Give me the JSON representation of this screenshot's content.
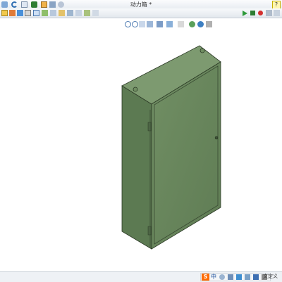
{
  "window": {
    "title": "动力箱 *"
  },
  "toolbar": {
    "help_label": "?",
    "row1_icons": [
      "home-icon",
      "undo-icon",
      "select-icon",
      "rebuild-icon",
      "save-icon",
      "print-icon",
      "options-icon"
    ],
    "row2_icons": [
      "sketch-icon",
      "smart-dimension-icon",
      "line-icon",
      "rectangle-icon",
      "circle-icon",
      "arc-icon",
      "spline-icon",
      "mirror-icon",
      "feature-icon",
      "view-icon",
      "appearance-icon",
      "reference-icon"
    ],
    "run_icons": [
      "play-icon",
      "stop-icon",
      "record-icon",
      "macro-icon",
      "edit-macro-icon"
    ]
  },
  "heads_up": {
    "icons": [
      "zoom-to-fit-icon",
      "zoom-area-icon",
      "previous-view-icon",
      "section-view-icon",
      "view-orientation-icon",
      "display-style-icon",
      "hide-show-icon",
      "edit-appearance-icon",
      "apply-scene-icon",
      "view-settings-icon"
    ]
  },
  "model": {
    "name": "动力箱",
    "color": "#6b8b5d"
  },
  "statusbar": {
    "ime_label": "中",
    "ime_brand": "S",
    "status_text": "文定义"
  },
  "colors": {
    "cabinet_front": "#6f8f63",
    "cabinet_side": "#5c7a52",
    "cabinet_top": "#7d9a70",
    "edge": "#2d3b27"
  }
}
